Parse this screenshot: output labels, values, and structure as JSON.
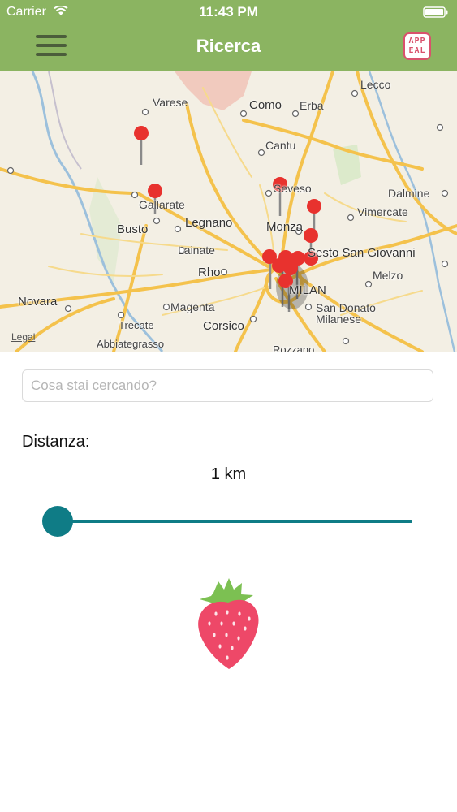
{
  "status_bar": {
    "carrier": "Carrier",
    "time": "11:43 PM"
  },
  "nav": {
    "title": "Ricerca",
    "logo_line1": "APP",
    "logo_line2": "EAL",
    "menu_icon": "hamburger-menu-icon"
  },
  "map": {
    "places": {
      "varese": "Varese",
      "como": "Como",
      "erba": "Erba",
      "lecco": "Lecco",
      "cantu": "Cantu",
      "seveso": "Seveso",
      "dalmine": "Dalmine",
      "gallarate": "Gallarate",
      "vimercate": "Vimercate",
      "legnano": "Legnano",
      "busto": "Busto",
      "monza": "Monza",
      "lainate": "Lainate",
      "sesto": "Sesto San Giovanni",
      "rho": "Rho",
      "melzo": "Melzo",
      "milan": "MILAN",
      "novara": "Novara",
      "magenta": "Magenta",
      "san_donato": "San Donato",
      "milanese": "Milanese",
      "trecate": "Trecate",
      "corsico": "Corsico",
      "abbiategrasso": "Abbiategrasso",
      "rozzano": "Rozzano"
    },
    "legal": "Legal"
  },
  "search": {
    "placeholder": "Cosa stai cercando?",
    "value": ""
  },
  "distance": {
    "label": "Distanza:",
    "value_text": "1 km",
    "slider_fraction": 0
  },
  "colors": {
    "header": "#8bb461",
    "accent": "#0f7c86",
    "pin": "#e8322e",
    "logo": "#d9526c"
  }
}
